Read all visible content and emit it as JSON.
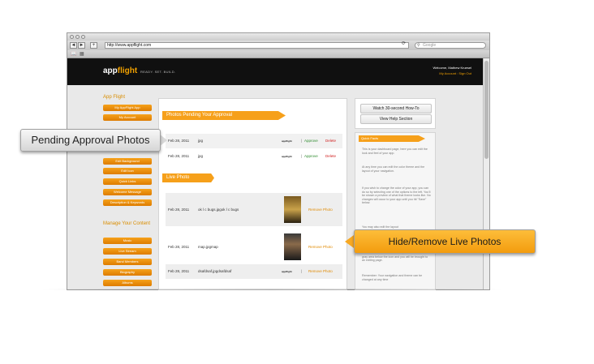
{
  "browser": {
    "url": "http://www.appflight.com",
    "search_placeholder": "Google",
    "back": "◄",
    "forward": "►",
    "add": "+"
  },
  "header": {
    "logo_app": "app",
    "logo_flight": "flight",
    "tagline": "READY. SET. BUILD.",
    "welcome": "Welcome, Mathew Kruesel",
    "account_links": "My Account : Sign Out"
  },
  "sidebar": {
    "section1_title": "App Flight",
    "section1_items": [
      "My AppFlight App",
      "My Account"
    ],
    "section2_items": [
      "Edit Background",
      "Edit Icon",
      "Quick Links",
      "Welcome Message",
      "Description & Keywords"
    ],
    "section3_title": "Manage Your Content",
    "section3_items": [
      "Music",
      "Live Stream",
      "Band Members",
      "Biography",
      "Albums"
    ]
  },
  "main": {
    "pending_title": "Photos Pending Your Approval",
    "pending_rows": [
      {
        "date": "Feb 28, 2011",
        "file": "jpg",
        "logo": "appflight",
        "approve": "Approve",
        "delete": "Delete"
      },
      {
        "date": "Feb 28, 2011",
        "file": "jpg",
        "logo": "appflight",
        "approve": "Approve",
        "delete": "Delete"
      }
    ],
    "live_title": "Live Photo",
    "live_rows": [
      {
        "date": "Feb 28, 2011",
        "file": "ok l c bugs.jpgok l c bugs",
        "action": "Remove Photo"
      },
      {
        "date": "Feb 28, 2011",
        "file": "map.jpgmap",
        "action": "Remove Photo"
      },
      {
        "date": "Feb 28, 2011",
        "file": "dsafdsaf.jpgdsafdsaf",
        "action": "Remove Photo"
      }
    ]
  },
  "help": {
    "watch_label": "Watch 30-second How-To",
    "view_label": "View Help Section"
  },
  "facts": {
    "title": "Quick Facts",
    "paragraphs": [
      "This is your dashboard page, here you can edit the look and feel of your app.",
      "At any time you can edit the color theme and the layout of your navigation.",
      "If you wish to change the color of your app, you can do so by selecting one of the options to the left. You'll be shown a preview of what that theme looks like. No changes will occur to your app until you hit \"Save\" below.",
      "You may also edit the layout",
      "To edit the title/icon of a section, click the file in the gray area below the icon and you will be brought to an editing page.",
      "Remember: Your navigation and theme can be changed at any time"
    ]
  },
  "callouts": {
    "pending": "Pending Approval Photos",
    "remove": "Hide/Remove Live Photos"
  }
}
